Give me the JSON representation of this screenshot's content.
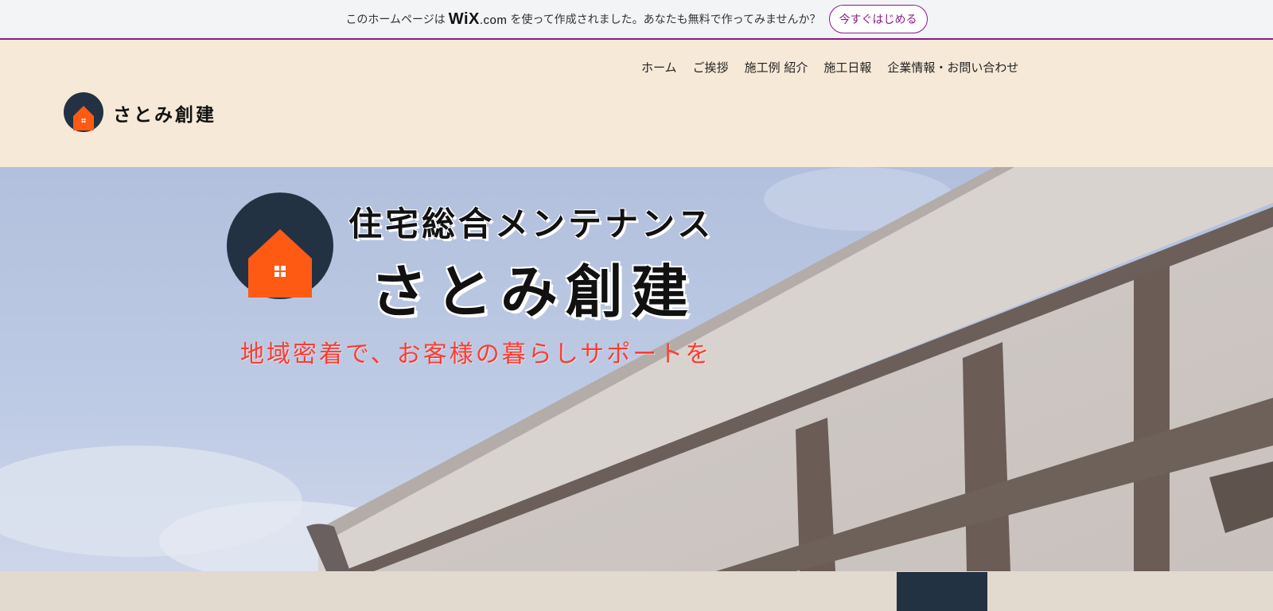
{
  "wix_banner": {
    "text_before": "このホームページは",
    "logo_main": "WiX",
    "logo_suffix": ".com",
    "text_after": "を使って作成されました。あなたも無料で作ってみませんか？",
    "cta_label": "今すぐはじめる"
  },
  "header": {
    "site_name": "さとみ創建",
    "nav": [
      "ホーム",
      "ご挨拶",
      "施工例 紹介",
      "施工日報",
      "企業情報・お問い合わせ"
    ]
  },
  "hero": {
    "title_line1": "住宅総合メンテナンス",
    "title_line2": "さとみ創建",
    "tagline": "地域密着で、お客様の暮らしサポートを"
  },
  "colors": {
    "header_bg": "#f6e9d8",
    "logo_navy": "#223242",
    "logo_orange": "#ff5a14",
    "tagline_red": "#ff3b2f",
    "wix_purple": "#8a1a8a"
  }
}
